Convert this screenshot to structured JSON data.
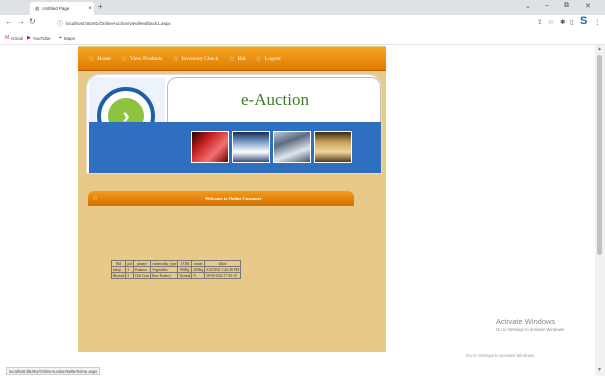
{
  "browser": {
    "tab_title": "Untitled Page",
    "tab_close": "×",
    "new_tab": "+",
    "window_controls": [
      "⌄",
      "–",
      "⧉",
      "✕"
    ],
    "url": "localhost:55491/OnlineAuction/viewfeedback1.aspx",
    "bookmarks": [
      {
        "icon": "gmail-icon",
        "label": "Gmail"
      },
      {
        "icon": "youtube-icon",
        "label": "YouTube"
      },
      {
        "icon": "maps-icon",
        "label": "Maps"
      }
    ]
  },
  "site": {
    "menu": [
      "Home",
      "View Products",
      "Inventory Check",
      "Bid",
      "Logout"
    ],
    "title": "e-Auction",
    "welcome": "Welcome to Online Customer",
    "bids_table": {
      "headers": [
        "Bid",
        "pid",
        "pname",
        "commodity_type",
        "UOM",
        "mrate",
        "sDate"
      ],
      "rows": [
        [
          "balaji",
          "3",
          "Potatoes",
          "Vegetables",
          "100Kg",
          "200Kg",
          "3/25/2021 1:42:48 PM"
        ],
        [
          "Bharath",
          "2",
          "Chil Com",
          "Raw Product",
          "Normal",
          "N",
          "28-03-2022 17:30:16"
        ]
      ]
    }
  },
  "os": {
    "activate_heading": "Activate Windows",
    "activate_sub": "Go to Settings to activate Windows.",
    "activate_sub2": "Go to Settings to activate Windows."
  },
  "statusbar": {
    "text": "localhost:55491/OnlineAuction/sellerhome.aspx"
  },
  "colors": {
    "menu_orange": "#e07b00",
    "title_green": "#3b7f22",
    "page_tan": "#e8c98a",
    "banner_blue": "#2f6fc0"
  }
}
